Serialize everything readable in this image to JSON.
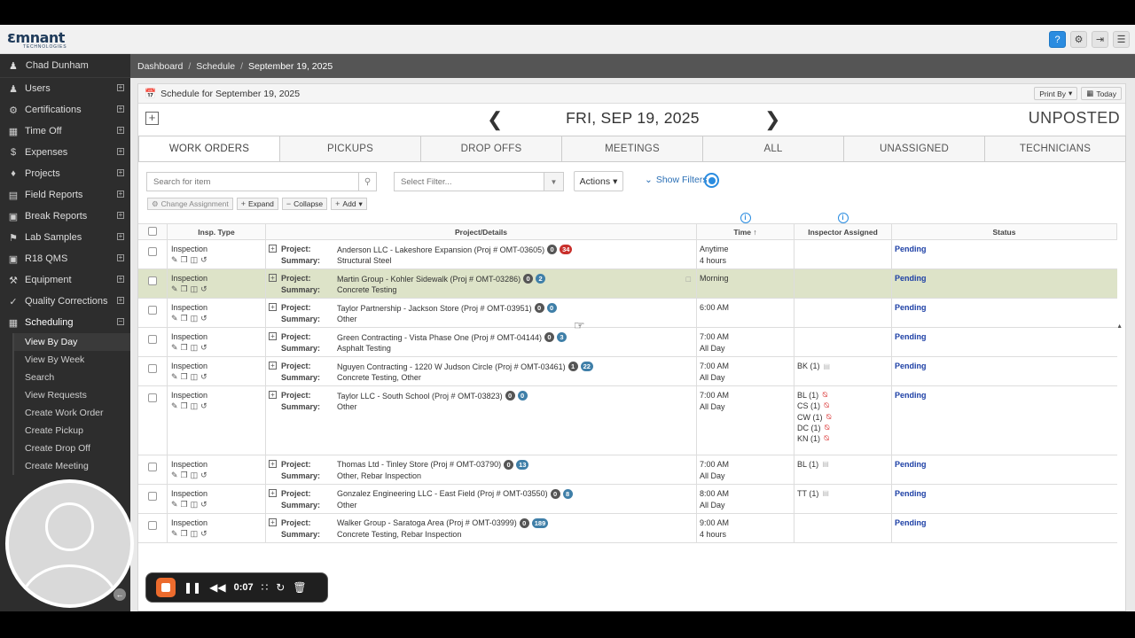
{
  "app": {
    "logo_text": "mnant",
    "logo_sub": "TECHNOLOGIES",
    "top_icons": [
      "help-icon",
      "gear-icon",
      "logout-icon",
      "menu-icon"
    ]
  },
  "sidebar": {
    "user": "Chad Dunham",
    "items": [
      {
        "label": "Users",
        "icon": "users-icon"
      },
      {
        "label": "Certifications",
        "icon": "certificate-icon"
      },
      {
        "label": "Time Off",
        "icon": "calendar-icon"
      },
      {
        "label": "Expenses",
        "icon": "dollar-icon"
      },
      {
        "label": "Projects",
        "icon": "puzzle-icon"
      },
      {
        "label": "Field Reports",
        "icon": "report-icon"
      },
      {
        "label": "Break Reports",
        "icon": "cube-icon"
      },
      {
        "label": "Lab Samples",
        "icon": "tag-icon"
      },
      {
        "label": "R18 QMS",
        "icon": "r18-icon"
      },
      {
        "label": "Equipment",
        "icon": "wrench-icon"
      },
      {
        "label": "Quality Corrections",
        "icon": "check-icon"
      },
      {
        "label": "Scheduling",
        "icon": "calendar-icon"
      }
    ],
    "sub_items": [
      "View By Day",
      "View By Week",
      "Search",
      "View Requests",
      "Create Work Order",
      "Create Pickup",
      "Create Drop Off",
      "Create Meeting"
    ]
  },
  "breadcrumb": {
    "items": [
      "Dashboard",
      "Schedule",
      "September 19, 2025"
    ]
  },
  "panel": {
    "title": "Schedule for September 19, 2025",
    "print_by": "Print By",
    "today": "Today",
    "date": "FRI, SEP 19, 2025",
    "posted_state": "UNPOSTED"
  },
  "tabs": [
    "WORK ORDERS",
    "PICKUPS",
    "DROP OFFS",
    "MEETINGS",
    "ALL",
    "UNASSIGNED",
    "TECHNICIANS"
  ],
  "filters": {
    "search_placeholder": "Search for item",
    "select_placeholder": "Select Filter...",
    "actions": "Actions",
    "show_filters": "Show Filters",
    "buttons": [
      "Change Assignment",
      "Expand",
      "Collapse",
      "Add"
    ]
  },
  "table": {
    "headers": [
      "Insp. Type",
      "Project/Details",
      "Time",
      "Inspector Assigned",
      "Status"
    ],
    "project_label": "Project:",
    "summary_label": "Summary:",
    "rows": [
      {
        "type": "Inspection",
        "project": "Anderson LLC - Lakeshore Expansion (Proj # OMT-03605)",
        "b1": "0",
        "b2": "34",
        "b2color": "red",
        "summary": "Structural Steel",
        "time1": "Anytime",
        "time2": "4 hours",
        "inspectors": [],
        "status": "Pending"
      },
      {
        "type": "Inspection",
        "project": "Martin Group - Kohler Sidewalk (Proj # OMT-03286)",
        "b1": "0",
        "b2": "2",
        "b2color": "blue",
        "summary": "Concrete Testing",
        "time1": "Morning",
        "time2": "",
        "inspectors": [],
        "status": "Pending"
      },
      {
        "type": "Inspection",
        "project": "Taylor Partnership - Jackson Store (Proj # OMT-03951)",
        "b1": "0",
        "b2": "0",
        "b2color": "blue",
        "summary": "Other",
        "time1": "6:00 AM",
        "time2": "",
        "inspectors": [],
        "status": "Pending"
      },
      {
        "type": "Inspection",
        "project": "Green Contracting - Vista Phase One (Proj # OMT-04144)",
        "b1": "0",
        "b2": "3",
        "b2color": "blue",
        "summary": "Asphalt Testing",
        "time1": "7:00 AM",
        "time2": "All Day",
        "inspectors": [],
        "status": "Pending"
      },
      {
        "type": "Inspection",
        "project": "Nguyen Contracting - 1220 W Judson Circle (Proj # OMT-03461)",
        "b1": "1",
        "b2": "22",
        "b2color": "blue",
        "summary": "Concrete Testing, Other",
        "time1": "7:00 AM",
        "time2": "All Day",
        "inspectors": [
          {
            "t": "BK (1)",
            "m": "doc"
          }
        ],
        "status": "Pending"
      },
      {
        "type": "Inspection",
        "project": "Taylor LLC - South School (Proj # OMT-03823)",
        "b1": "0",
        "b2": "0",
        "b2color": "blue",
        "summary": "Other",
        "time1": "7:00 AM",
        "time2": "All Day",
        "inspectors": [
          {
            "t": "BL (1)",
            "m": "no"
          },
          {
            "t": "CS (1)",
            "m": "no"
          },
          {
            "t": "CW (1)",
            "m": "no"
          },
          {
            "t": "DC (1)",
            "m": "no"
          },
          {
            "t": "KN (1)",
            "m": "no"
          }
        ],
        "status": "Pending"
      },
      {
        "type": "Inspection",
        "project": "Thomas Ltd - Tinley Store (Proj # OMT-03790)",
        "b1": "0",
        "b2": "13",
        "b2color": "blue",
        "summary": "Other, Rebar Inspection",
        "time1": "7:00 AM",
        "time2": "All Day",
        "inspectors": [
          {
            "t": "BL (1)",
            "m": "doc"
          }
        ],
        "status": "Pending"
      },
      {
        "type": "Inspection",
        "project": "Gonzalez Engineering LLC - East Field (Proj # OMT-03550)",
        "b1": "0",
        "b2": "8",
        "b2color": "blue",
        "summary": "Other",
        "time1": "8:00 AM",
        "time2": "All Day",
        "inspectors": [
          {
            "t": "TT (1)",
            "m": "doc"
          }
        ],
        "status": "Pending"
      },
      {
        "type": "Inspection",
        "project": "Walker Group - Saratoga Area (Proj # OMT-03999)",
        "b1": "0",
        "b2": "189",
        "b2color": "blue",
        "summary": "Concrete Testing, Rebar Inspection",
        "time1": "9:00 AM",
        "time2": "4 hours",
        "inspectors": [],
        "status": "Pending"
      }
    ]
  },
  "recorder": {
    "time": "0:07"
  }
}
